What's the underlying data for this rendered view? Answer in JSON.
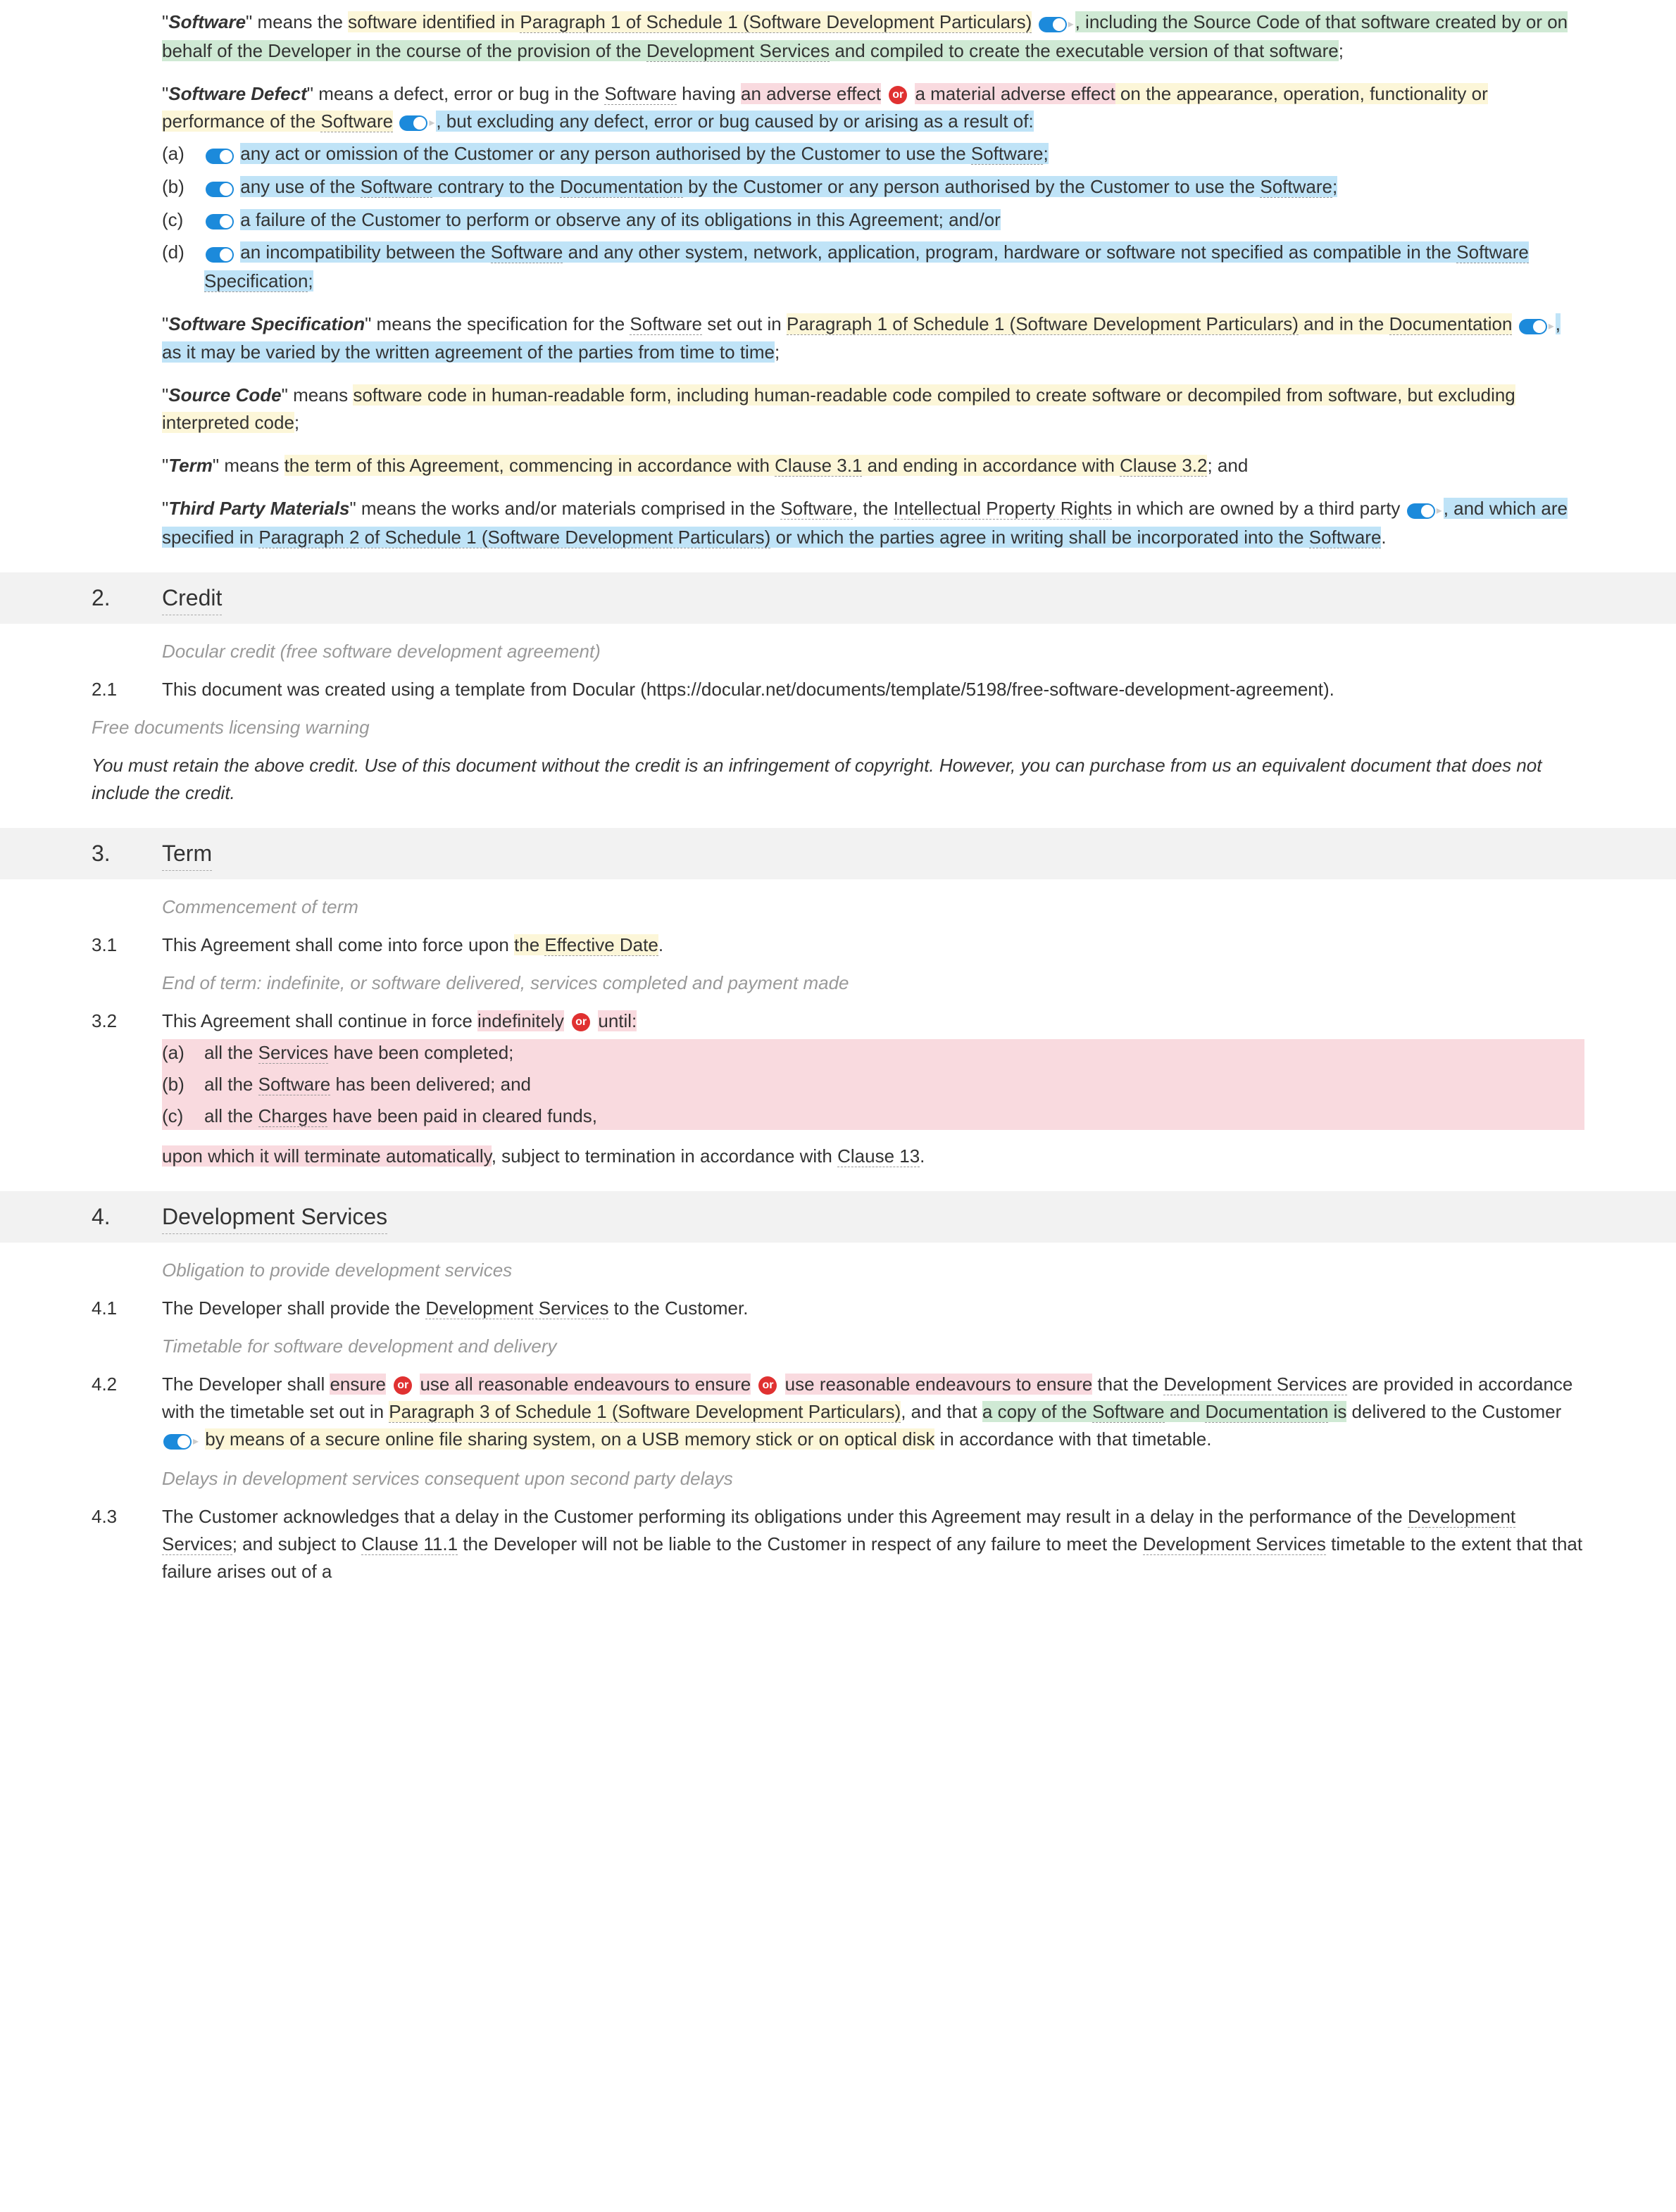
{
  "or_label": "or",
  "defs": {
    "software": {
      "term": "Software",
      "t1a": "\" means the ",
      "t1b": "software identified in ",
      "t1c": "Paragraph 1 of Schedule 1 (Software Development Particulars)",
      "t2a": ", including the Source Code of that software created by or on behalf of the Developer in the course of the provision of the ",
      "t2b": "Development Services",
      "t2c": " and compiled to create the executable version of that software",
      "t3": ";"
    },
    "defect": {
      "term": "Software Defect",
      "t1a": "\" means a defect, error or bug in the ",
      "t1b": "Software",
      "t1c": " having ",
      "opt1": "an adverse effect",
      "opt2": "a material adverse effect",
      "t2a": " on the appearance, operation, functionality or performance of the ",
      "t2b": "Software",
      "t3": ", but excluding any defect, error or bug caused by or arising as a result of:",
      "a_lbl": "(a)",
      "a_txt": "any act or omission of the Customer or any person authorised by the Customer to use the ",
      "a_sw": "Software",
      "a_end": ";",
      "b_lbl": "(b)",
      "b_txt1": "any use of the ",
      "b_sw1": "Software",
      "b_txt2": " contrary to the ",
      "b_doc": "Documentation",
      "b_txt3": " by the Customer or any person authorised by the Customer to use the ",
      "b_sw2": "Software",
      "b_end": ";",
      "c_lbl": "(c)",
      "c_txt": "a failure of the Customer to perform or observe any of its obligations in this Agreement; and/or",
      "d_lbl": "(d)",
      "d_txt1": "an incompatibility between the ",
      "d_sw": "Software",
      "d_txt2": " and any other system, network, application, program, hardware or software not specified as compatible in the ",
      "d_spec": "Software Specification",
      "d_end": ";"
    },
    "spec": {
      "term": "Software Specification",
      "t1a": "\" means the specification for the ",
      "t1b": "Software",
      "t1c": " set out in ",
      "t1d": "Paragraph 1 of Schedule 1 (Software Development Particulars)",
      "t1e": " and in the ",
      "t1f": "Documentation",
      "t2": ", as it may be varied by the written agreement of the parties from time to time",
      "t3": ";"
    },
    "source": {
      "term": "Source Code",
      "t1": "\" means ",
      "t2": "software code in human-readable form, including human-readable code compiled to create software or decompiled from software, but excluding interpreted code",
      "t3": ";"
    },
    "termdef": {
      "term": "Term",
      "t1": "\" means ",
      "t2": "the term of this Agreement, commencing in accordance with ",
      "t2b": "Clause 3.1",
      "t2c": " and ending in accordance with ",
      "t2d": "Clause 3.2",
      "t3": "; and"
    },
    "tpm": {
      "term": "Third Party Materials",
      "t1a": "\" means the works and/or materials comprised in the ",
      "t1b": "Software",
      "t1c": ", the ",
      "t1d": "Intellectual Property Rights",
      "t1e": " in which are owned by a third party",
      "t2a": ", and which are specified in ",
      "t2b": "Paragraph 2 of Schedule 1 (Software Development Particulars)",
      "t2c": " or which the parties agree in writing shall be incorporated into the ",
      "t2d": "Software",
      "t3": "."
    }
  },
  "s2": {
    "num": "2.",
    "title": "Credit",
    "note": "Docular credit (free software development agreement)",
    "c1_num": "2.1",
    "c1_txt": "This document was created using a template from Docular (https://docular.net/documents/template/5198/free-software-development-agreement).",
    "warn_title": "Free documents licensing warning",
    "warn_body": "You must retain the above credit. Use of this document without the credit is an infringement of copyright. However, you can purchase from us an equivalent document that does not include the credit."
  },
  "s3": {
    "num": "3.",
    "title": "Term",
    "note1": "Commencement of term",
    "c1_num": "3.1",
    "c1_a": "This Agreement shall come into force upon ",
    "c1_b": "the ",
    "c1_c": "Effective Date",
    "c1_d": ".",
    "note2": "End of term: indefinite, or software delivered, services completed and payment made",
    "c2_num": "3.2",
    "c2_a": "This Agreement shall continue in force ",
    "c2_opt1": "indefinitely",
    "c2_opt2": "until:",
    "c2_sa_lbl": "(a)",
    "c2_sa": "all the ",
    "c2_sa_u": "Services",
    "c2_sa_e": " have been completed;",
    "c2_sb_lbl": "(b)",
    "c2_sb": "all the ",
    "c2_sb_u": "Software",
    "c2_sb_e": " has been delivered; and",
    "c2_sc_lbl": "(c)",
    "c2_sc": "all the ",
    "c2_sc_u": "Charges",
    "c2_sc_e": " have been paid in cleared funds,",
    "c2_tail1": "upon which it will terminate automatically",
    "c2_tail2": ", subject to termination in accordance with ",
    "c2_tail3": "Clause 13",
    "c2_tail4": "."
  },
  "s4": {
    "num": "4.",
    "title": "Development Services",
    "note1": "Obligation to provide development services",
    "c1_num": "4.1",
    "c1_a": "The Developer shall provide the ",
    "c1_b": "Development Services",
    "c1_c": " to the Customer.",
    "note2": "Timetable for software development and delivery",
    "c2_num": "4.2",
    "c2_a": "The Developer shall ",
    "c2_opt1": "ensure",
    "c2_opt2": "use all reasonable endeavours to ensure",
    "c2_opt3": "use reasonable endeavours to ensure",
    "c2_b": " that the ",
    "c2_c": "Development Services",
    "c2_d": " are provided in accordance with the timetable set out in ",
    "c2_e": "Paragraph 3 of Schedule 1 (Software Development Particulars)",
    "c2_f": ", and that ",
    "c2_g": "a copy of the ",
    "c2_g2": "Software",
    "c2_g3": " and ",
    "c2_g4": "Documentation",
    "c2_g5": " is",
    "c2_h": " delivered to the Customer ",
    "c2_i": "by means of a secure online file sharing system, on a USB memory stick or on optical disk",
    "c2_j": " in accordance with that timetable.",
    "note3": "Delays in development services consequent upon second party delays",
    "c3_num": "4.3",
    "c3_a": "The Customer acknowledges that a delay in the Customer performing its obligations under this Agreement may result in a delay in the performance of the ",
    "c3_b": "Development Services",
    "c3_c": "; and subject to ",
    "c3_d": "Clause 11.1",
    "c3_e": " the Developer will not be liable to the Customer in respect of any failure to meet the ",
    "c3_f": "Development Services",
    "c3_g": " timetable to the extent that that failure arises out of a"
  }
}
